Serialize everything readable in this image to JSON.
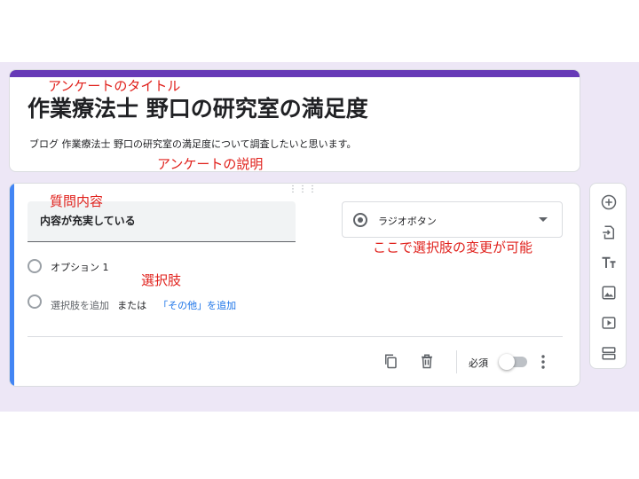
{
  "form": {
    "title": "作業療法士 野口の研究室の満足度",
    "description": "ブログ 作業療法士 野口の研究室の満足度について調査したいと思います。"
  },
  "question": {
    "text": "内容が充実している",
    "type_label": "ラジオボタン",
    "options": [
      {
        "label": "オプション 1"
      }
    ],
    "add_option": "選択肢を追加",
    "or_text": "または",
    "add_other": "「その他」を追加",
    "required_label": "必須",
    "required": false
  },
  "annotations": {
    "title": "アンケートのタイトル",
    "description": "アンケートの説明",
    "question": "質問内容",
    "options": "選択肢",
    "type": "ここで選択肢の変更が可能"
  },
  "colors": {
    "accent": "#673ab7",
    "active_bar": "#4285f4",
    "annotation": "#e0201b",
    "link": "#1a73e8"
  },
  "side_toolbar": [
    "add-question-icon",
    "import-questions-icon",
    "add-title-icon",
    "add-image-icon",
    "add-video-icon",
    "add-section-icon"
  ]
}
